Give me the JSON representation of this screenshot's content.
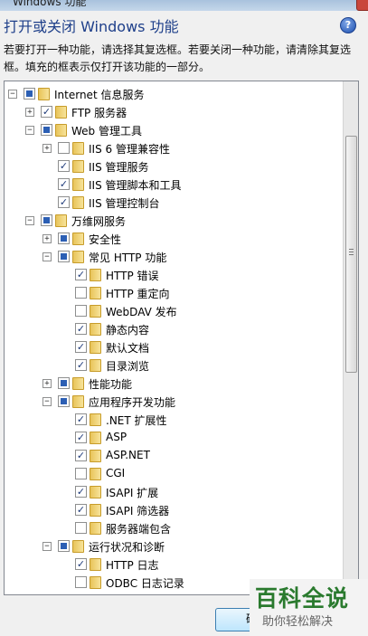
{
  "window": {
    "title": "Windows 功能",
    "heading": "打开或关闭 Windows 功能",
    "description": "若要打开一种功能，请选择其复选框。若要关闭一种功能，请清除其复选框。填充的框表示仅打开该功能的一部分。",
    "help_symbol": "?",
    "ok_label": "确定"
  },
  "tree": [
    {
      "label": "Internet 信息服务",
      "level": 0,
      "expander": "−",
      "state": "partial"
    },
    {
      "label": "FTP 服务器",
      "level": 1,
      "expander": "+",
      "state": "checked"
    },
    {
      "label": "Web 管理工具",
      "level": 1,
      "expander": "−",
      "state": "partial"
    },
    {
      "label": "IIS 6 管理兼容性",
      "level": 2,
      "expander": "+",
      "state": "unchecked"
    },
    {
      "label": "IIS 管理服务",
      "level": 2,
      "expander": "",
      "state": "checked"
    },
    {
      "label": "IIS 管理脚本和工具",
      "level": 2,
      "expander": "",
      "state": "checked"
    },
    {
      "label": "IIS 管理控制台",
      "level": 2,
      "expander": "",
      "state": "checked"
    },
    {
      "label": "万维网服务",
      "level": 1,
      "expander": "−",
      "state": "partial"
    },
    {
      "label": "安全性",
      "level": 2,
      "expander": "+",
      "state": "partial"
    },
    {
      "label": "常见 HTTP 功能",
      "level": 2,
      "expander": "−",
      "state": "partial"
    },
    {
      "label": "HTTP 错误",
      "level": 3,
      "expander": "",
      "state": "checked"
    },
    {
      "label": "HTTP 重定向",
      "level": 3,
      "expander": "",
      "state": "unchecked"
    },
    {
      "label": "WebDAV 发布",
      "level": 3,
      "expander": "",
      "state": "unchecked"
    },
    {
      "label": "静态内容",
      "level": 3,
      "expander": "",
      "state": "checked"
    },
    {
      "label": "默认文档",
      "level": 3,
      "expander": "",
      "state": "checked"
    },
    {
      "label": "目录浏览",
      "level": 3,
      "expander": "",
      "state": "checked"
    },
    {
      "label": "性能功能",
      "level": 2,
      "expander": "+",
      "state": "partial"
    },
    {
      "label": "应用程序开发功能",
      "level": 2,
      "expander": "−",
      "state": "partial"
    },
    {
      "label": ".NET 扩展性",
      "level": 3,
      "expander": "",
      "state": "checked"
    },
    {
      "label": "ASP",
      "level": 3,
      "expander": "",
      "state": "checked"
    },
    {
      "label": "ASP.NET",
      "level": 3,
      "expander": "",
      "state": "checked"
    },
    {
      "label": "CGI",
      "level": 3,
      "expander": "",
      "state": "unchecked"
    },
    {
      "label": "ISAPI 扩展",
      "level": 3,
      "expander": "",
      "state": "checked"
    },
    {
      "label": "ISAPI 筛选器",
      "level": 3,
      "expander": "",
      "state": "checked"
    },
    {
      "label": "服务器端包含",
      "level": 3,
      "expander": "",
      "state": "unchecked"
    },
    {
      "label": "运行状况和诊断",
      "level": 2,
      "expander": "−",
      "state": "partial"
    },
    {
      "label": "HTTP 日志",
      "level": 3,
      "expander": "",
      "state": "checked"
    },
    {
      "label": "ODBC 日志记录",
      "level": 3,
      "expander": "",
      "state": "unchecked"
    }
  ],
  "watermark": {
    "main": "百科全说",
    "sub": "助你轻松解决"
  }
}
